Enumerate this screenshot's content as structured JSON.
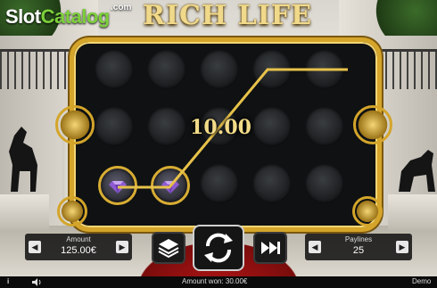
{
  "branding": {
    "logo_slot": "Slot",
    "logo_catalog": "Catalog",
    "logo_com": ".com"
  },
  "game": {
    "title": "RICH LIFE",
    "win_amount": "10.00"
  },
  "controls": {
    "amount_label": "Amount",
    "amount_value": "125.00€",
    "paylines_label": "Paylines",
    "paylines_value": "25",
    "arrow_left": "◀",
    "arrow_right": "▶"
  },
  "status": {
    "info": "i",
    "amount_won": "Amount won: 30.00€",
    "mode": "Demo"
  },
  "icons": [
    "info-icon",
    "sound-icon",
    "stack-icon",
    "spin-icon",
    "fast-forward-icon",
    "gem-icon"
  ],
  "colors": {
    "gold": "#d4a52a",
    "gem": "#8e5ad1",
    "logo_green": "#7ccf3a"
  }
}
